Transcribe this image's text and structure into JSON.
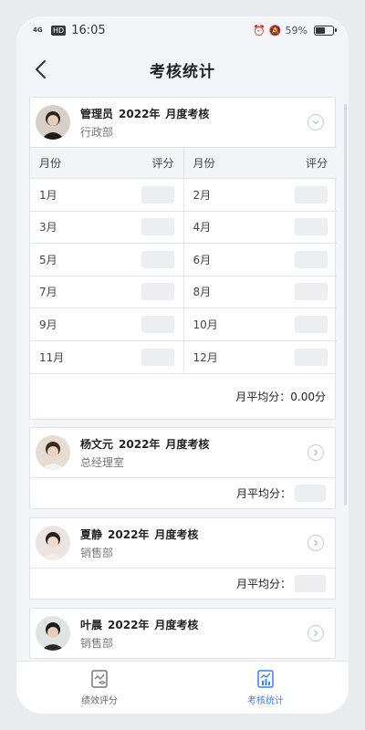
{
  "status_bar": {
    "time": "16:05",
    "signal": "4G",
    "hd": "HD",
    "battery_text": "59%",
    "battery_level": 0.59
  },
  "header": {
    "title": "考核统计"
  },
  "table_headers": {
    "month": "月份",
    "score": "评分"
  },
  "cards": [
    {
      "name": "管理员",
      "year": "2022年",
      "type": "月度考核",
      "dept": "行政部",
      "expanded": true,
      "months": [
        [
          "1月",
          "2月"
        ],
        [
          "3月",
          "4月"
        ],
        [
          "5月",
          "6月"
        ],
        [
          "7月",
          "8月"
        ],
        [
          "9月",
          "10月"
        ],
        [
          "11月",
          "12月"
        ]
      ],
      "avg_label": "月平均分：",
      "avg_value": "0.00分"
    },
    {
      "name": "杨文元",
      "year": "2022年",
      "type": "月度考核",
      "dept": "总经理室",
      "avg_label": "月平均分："
    },
    {
      "name": "夏静",
      "year": "2022年",
      "type": "月度考核",
      "dept": "销售部",
      "avg_label": "月平均分："
    },
    {
      "name": "叶晨",
      "year": "2022年",
      "type": "月度考核",
      "dept": "销售部"
    }
  ],
  "tabs": [
    {
      "label": "绩效评分",
      "active": false,
      "icon": "performance-icon"
    },
    {
      "label": "考核统计",
      "active": true,
      "icon": "statistics-icon"
    }
  ],
  "colors": {
    "accent": "#3a7ef6",
    "background": "#f4f5f8"
  }
}
